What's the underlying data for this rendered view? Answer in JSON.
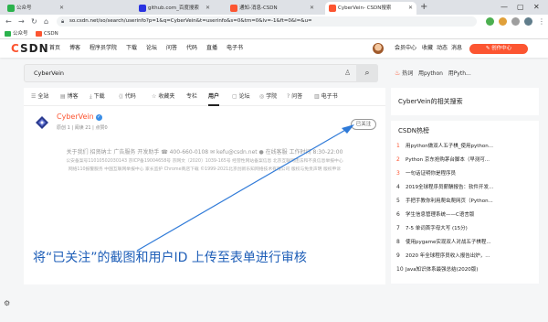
{
  "browser": {
    "tabs": [
      {
        "label": "公众号",
        "color": "#2bb24c"
      },
      {
        "label": "github.com_百度搜索",
        "color": "#2932e1"
      },
      {
        "label": "通知-消息-CSDN",
        "color": "#fc5531"
      },
      {
        "label": "CyberVein- CSDN搜索",
        "color": "#fc5531"
      }
    ],
    "new_tab": "+",
    "window_controls": [
      "—",
      "▢",
      "✕"
    ],
    "url": "so.csdn.net/so/search/userinfo?p=1&q=CyberVein&t=userinfo&s=0&tm=0&lv=-1&ft=0&l=&u=",
    "bookmarks": [
      {
        "label": "公众号",
        "color": "#2bb24c"
      },
      {
        "label": "CSDN",
        "color": "#fc5531"
      }
    ]
  },
  "csdn_header": {
    "logo_c": "C",
    "logo_rest": "SDN",
    "nav": [
      "首页",
      "博客",
      "程序员学院",
      "下载",
      "论坛",
      "问答",
      "代码",
      "直播",
      "电子书"
    ],
    "right": [
      "会员中心",
      "收藏",
      "动态",
      "消息"
    ],
    "create_label": "✎ 创作中心"
  },
  "search": {
    "query": "CyberVein",
    "camera_icon": "♙",
    "button_icon": "⌕"
  },
  "hot": {
    "fire_icon": "♨",
    "label": "热词",
    "items": [
      "用python",
      "用Pyth..."
    ]
  },
  "filter_tabs": [
    {
      "icon": "☰",
      "label": "全站"
    },
    {
      "icon": "▤",
      "label": "博客"
    },
    {
      "icon": "⤓",
      "label": "下载"
    },
    {
      "icon": "⟨⟩",
      "label": "代码"
    },
    {
      "icon": "☆",
      "label": "收藏夹"
    },
    {
      "icon": "",
      "label": "专栏"
    },
    {
      "icon": "",
      "label": "用户"
    },
    {
      "icon": "▢",
      "label": "论坛"
    },
    {
      "icon": "◎",
      "label": "学院"
    },
    {
      "icon": "?",
      "label": "问答"
    },
    {
      "icon": "▥",
      "label": "电子书"
    }
  ],
  "user": {
    "name": "CyberVein",
    "verified_mark": "✓",
    "stats": "原创 1 | 阅读 21 | 点赞0",
    "follow_label": "已关注"
  },
  "footer": {
    "line1": "关于我们  招贤纳士  广告服务  开发助手  ☎ 400-660-0108  ✉ kefu@csdn.net  ● 在线客服  工作时间 8:30-22:00",
    "line2": "公安备案号11010502030143  京ICP备19004658号  京网文〔2020〕1039-165号  经营性网站备案信息  北京互联网违法和不良信息举报中心",
    "line3": "网络110报警服务  中国互联网举报中心  家长监护  Chrome商店下载  ©1999-2021北京创新乐知网络技术有限公司  版权与免责声明  版权申诉"
  },
  "sidebar": {
    "related_title": "CyberVein的相关搜索",
    "hot_title": "CSDN热榜",
    "hot_items": [
      "用python做双人五子棋_使用python...",
      "Python 京东抢购茅台脚本（早测可...",
      "一句话证明你是程序员",
      "2019全球程序员薪酬报告：软件开发...",
      "手把手教你利用爬虫爬网页（Python...",
      "学生信息管理系统——C语言版",
      "7-5 单词首字母大写 (15分)",
      "使用pygame实现双人对战五子棋程...",
      "2020 年全球程序员收入报告出炉，...",
      "Java知识体系最强总结(2020版)"
    ]
  },
  "annotation": {
    "caption": "将“已关注”的截图和用户ID 上传至表单进行审核",
    "color": "#1f5fb8"
  },
  "settings_icon": "⚙"
}
